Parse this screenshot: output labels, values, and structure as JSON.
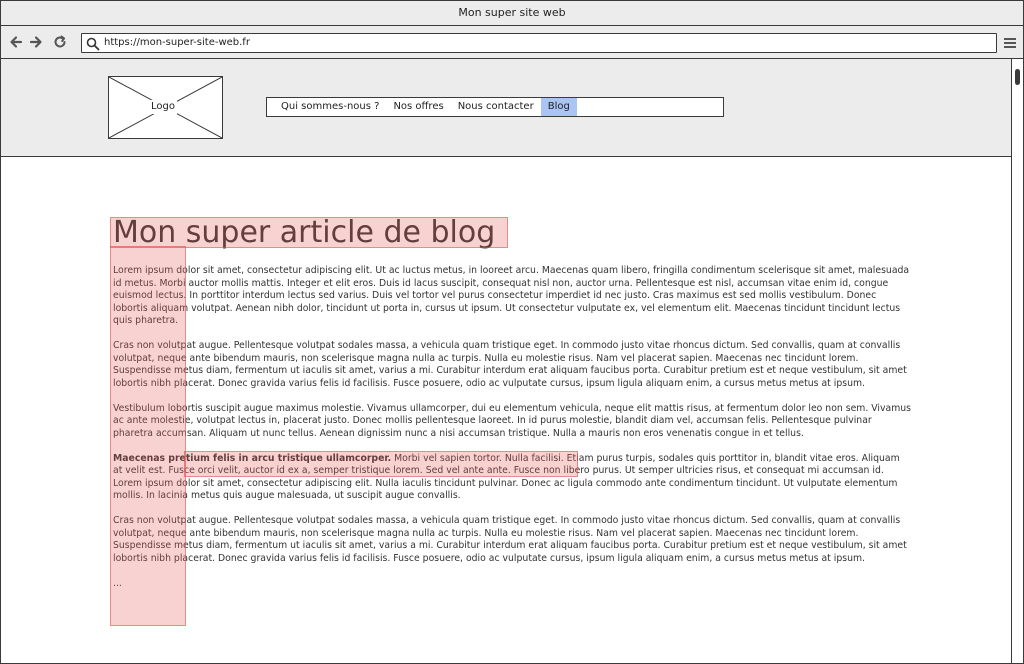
{
  "window": {
    "title": "Mon super site web"
  },
  "toolbar": {
    "url": "https://mon-super-site-web.fr"
  },
  "site": {
    "logo_label": "Logo",
    "nav": [
      {
        "label": "Qui sommes-nous ?",
        "active": false
      },
      {
        "label": "Nos offres",
        "active": false
      },
      {
        "label": "Nous contacter",
        "active": false
      },
      {
        "label": "Blog",
        "active": true
      }
    ]
  },
  "article": {
    "title": "Mon super article de blog",
    "paragraphs": [
      {
        "bold": "",
        "text": "Lorem ipsum dolor sit amet, consectetur adipiscing elit. Ut ac luctus metus, in looreet arcu. Maecenas quam libero, fringilla condimentum scelerisque sit amet, malesuada id metus. Morbi auctor mollis mattis. Integer et elit eros. Duis id lacus suscipit, consequat nisl non, auctor urna. Pellentesque est nisl, accumsan vitae enim id, congue euismod lectus. In porttitor interdum lectus sed varius. Duis vel tortor vel purus consectetur imperdiet id nec justo. Cras maximus est sed mollis vestibulum. Donec lobortis aliquam volutpat. Aenean nibh dolor, tincidunt ut porta in, cursus ut ipsum. Ut consectetur vulputate ex, vel elementum elit. Maecenas tincidunt tincidunt lectus quis pharetra."
      },
      {
        "bold": "",
        "text": "Cras non volutpat augue. Pellentesque volutpat sodales massa, a vehicula quam tristique eget. In commodo justo vitae rhoncus dictum. Sed convallis, quam at convallis volutpat, neque ante bibendum mauris, non scelerisque magna nulla ac turpis. Nulla eu molestie risus. Nam vel placerat sapien. Maecenas nec tincidunt lorem. Suspendisse metus diam, fermentum ut iaculis sit amet, varius a mi. Curabitur interdum erat aliquam faucibus porta. Curabitur pretium est et neque vestibulum, sit amet lobortis nibh placerat. Donec gravida varius felis id facilisis. Fusce posuere, odio ac vulputate cursus, ipsum ligula aliquam enim, a cursus metus metus at ipsum."
      },
      {
        "bold": "",
        "text": "Vestibulum lobortis suscipit augue maximus molestie. Vivamus ullamcorper, dui eu elementum vehicula, neque elit mattis risus, at fermentum dolor leo non sem. Vivamus ac ante molestie, volutpat lectus in, placerat justo. Donec mollis pellentesque laoreet. In id purus molestie, blandit diam vel, accumsan felis. Pellentesque pulvinar pharetra accumsan. Aliquam ut nunc tellus. Aenean dignissim nunc a nisi accumsan tristique. Nulla a mauris non eros venenatis congue in et tellus."
      },
      {
        "bold": "Maecenas pretium felis in arcu tristique ullamcorper.",
        "text": " Morbi vel sapien tortor. Nulla facilisi. Etiam purus turpis, sodales quis porttitor in, blandit vitae eros. Aliquam at velit est. Fusce orci velit, auctor id ex a, semper tristique lorem. Sed vel ante ante. Fusce non libero purus. Ut semper ultricies risus, et consequat mi accumsan id. Lorem ipsum dolor sit amet, consectetur adipiscing elit. Nulla iaculis tincidunt pulvinar. Donec ac ligula commodo ante condimentum tincidunt. Ut vulputate elementum mollis. In lacinia metus quis augue malesuada, ut suscipit augue convallis."
      },
      {
        "bold": "",
        "text": "Cras non volutpat augue. Pellentesque volutpat sodales massa, a vehicula quam tristique eget. In commodo justo vitae rhoncus dictum. Sed convallis, quam at convallis volutpat, neque ante bibendum mauris, non scelerisque magna nulla ac turpis. Nulla eu molestie risus. Nam vel placerat sapien. Maecenas nec tincidunt lorem. Suspendisse metus diam, fermentum ut iaculis sit amet, varius a mi. Curabitur interdum erat aliquam faucibus porta. Curabitur pretium est et neque vestibulum, sit amet lobortis nibh placerat. Donec gravida varius felis id facilisis. Fusce posuere, odio ac vulputate cursus, ipsum ligula aliquam enim, a cursus metus metus at ipsum."
      }
    ],
    "ellipsis": "..."
  },
  "colors": {
    "active_nav": "#a9c4f5",
    "highlight": "#e65a5a",
    "chrome": "#ececec"
  }
}
